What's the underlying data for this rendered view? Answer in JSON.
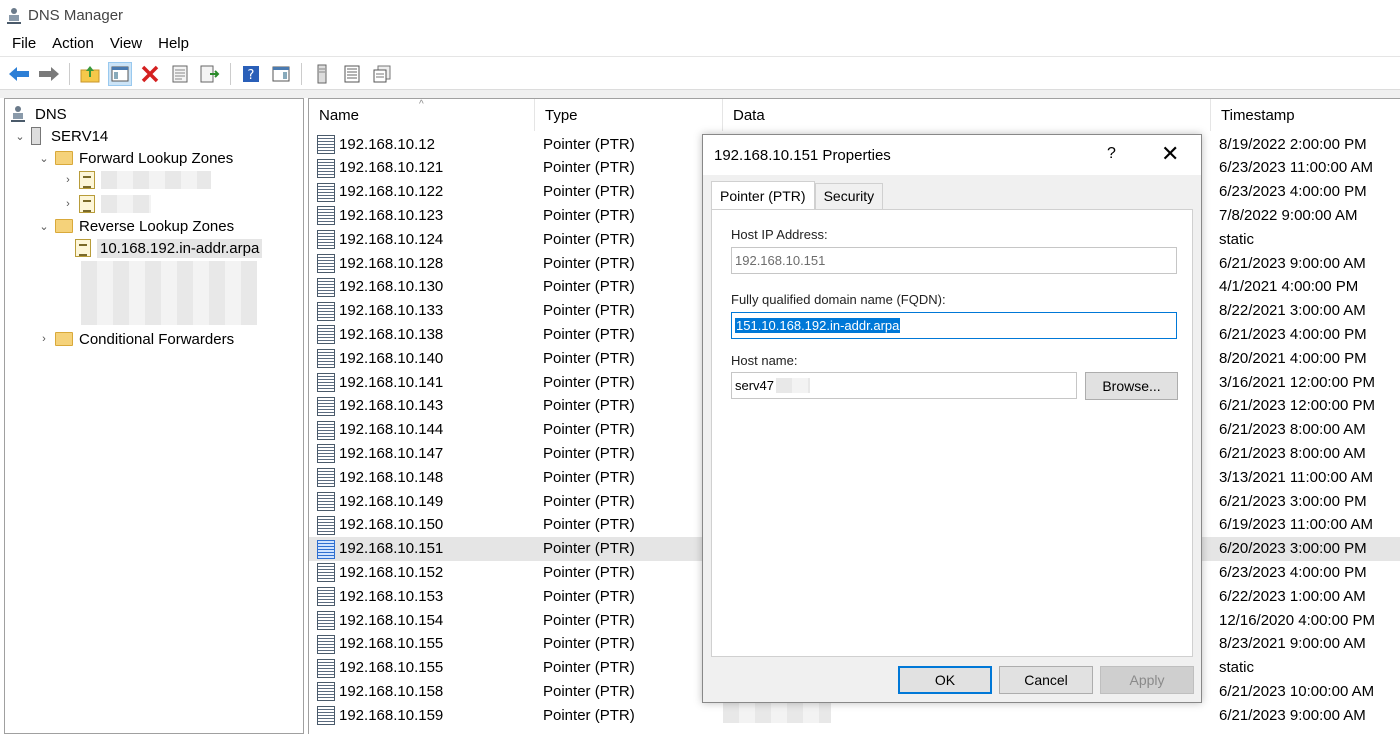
{
  "window": {
    "title": "DNS Manager"
  },
  "menu": [
    "File",
    "Action",
    "View",
    "Help"
  ],
  "toolbar": {
    "icons": [
      "back-arrow-icon",
      "forward-arrow-icon",
      "up-folder-icon",
      "show-hide-tree-icon",
      "delete-icon",
      "properties-icon",
      "export-list-icon",
      "help-icon",
      "action-pane-icon",
      "server-icon",
      "record-list-icon",
      "record-copy-icon"
    ]
  },
  "tree": {
    "root": "DNS",
    "server": "SERV14",
    "forward_zones": "Forward Lookup Zones",
    "reverse_zones": "Reverse Lookup Zones",
    "selected_zone": "10.168.192.in-addr.arpa",
    "conditional_forwarders": "Conditional Forwarders"
  },
  "columns": {
    "name": "Name",
    "type": "Type",
    "data": "Data",
    "timestamp": "Timestamp"
  },
  "records": [
    {
      "name": "192.168.10.12",
      "type": "Pointer (PTR)",
      "timestamp": "8/19/2022 2:00:00 PM"
    },
    {
      "name": "192.168.10.121",
      "type": "Pointer (PTR)",
      "timestamp": "6/23/2023 11:00:00 AM"
    },
    {
      "name": "192.168.10.122",
      "type": "Pointer (PTR)",
      "timestamp": "6/23/2023 4:00:00 PM"
    },
    {
      "name": "192.168.10.123",
      "type": "Pointer (PTR)",
      "timestamp": "7/8/2022 9:00:00 AM"
    },
    {
      "name": "192.168.10.124",
      "type": "Pointer (PTR)",
      "timestamp": "static"
    },
    {
      "name": "192.168.10.128",
      "type": "Pointer (PTR)",
      "timestamp": "6/21/2023 9:00:00 AM"
    },
    {
      "name": "192.168.10.130",
      "type": "Pointer (PTR)",
      "timestamp": "4/1/2021 4:00:00 PM"
    },
    {
      "name": "192.168.10.133",
      "type": "Pointer (PTR)",
      "timestamp": "8/22/2021 3:00:00 AM"
    },
    {
      "name": "192.168.10.138",
      "type": "Pointer (PTR)",
      "timestamp": "6/21/2023 4:00:00 PM"
    },
    {
      "name": "192.168.10.140",
      "type": "Pointer (PTR)",
      "timestamp": "8/20/2021 4:00:00 PM"
    },
    {
      "name": "192.168.10.141",
      "type": "Pointer (PTR)",
      "timestamp": "3/16/2021 12:00:00 PM"
    },
    {
      "name": "192.168.10.143",
      "type": "Pointer (PTR)",
      "timestamp": "6/21/2023 12:00:00 PM"
    },
    {
      "name": "192.168.10.144",
      "type": "Pointer (PTR)",
      "timestamp": "6/21/2023 8:00:00 AM"
    },
    {
      "name": "192.168.10.147",
      "type": "Pointer (PTR)",
      "timestamp": "6/21/2023 8:00:00 AM"
    },
    {
      "name": "192.168.10.148",
      "type": "Pointer (PTR)",
      "timestamp": "3/13/2021 11:00:00 AM"
    },
    {
      "name": "192.168.10.149",
      "type": "Pointer (PTR)",
      "timestamp": "6/21/2023 3:00:00 PM"
    },
    {
      "name": "192.168.10.150",
      "type": "Pointer (PTR)",
      "timestamp": "6/19/2023 11:00:00 AM"
    },
    {
      "name": "192.168.10.151",
      "type": "Pointer (PTR)",
      "timestamp": "6/20/2023 3:00:00 PM",
      "selected": true
    },
    {
      "name": "192.168.10.152",
      "type": "Pointer (PTR)",
      "timestamp": "6/23/2023 4:00:00 PM"
    },
    {
      "name": "192.168.10.153",
      "type": "Pointer (PTR)",
      "timestamp": "6/22/2023 1:00:00 AM"
    },
    {
      "name": "192.168.10.154",
      "type": "Pointer (PTR)",
      "timestamp": "12/16/2020 4:00:00 PM"
    },
    {
      "name": "192.168.10.155",
      "type": "Pointer (PTR)",
      "timestamp": "8/23/2021 9:00:00 AM"
    },
    {
      "name": "192.168.10.155",
      "type": "Pointer (PTR)",
      "timestamp": "static"
    },
    {
      "name": "192.168.10.158",
      "type": "Pointer (PTR)",
      "timestamp": "6/21/2023 10:00:00 AM"
    },
    {
      "name": "192.168.10.159",
      "type": "Pointer (PTR)",
      "timestamp": "6/21/2023 9:00:00 AM"
    }
  ],
  "dialog": {
    "title": "192.168.10.151 Properties",
    "help": "?",
    "close": "✕",
    "tabs": [
      "Pointer (PTR)",
      "Security"
    ],
    "host_ip_label": "Host IP Address:",
    "host_ip_value": "192.168.10.151",
    "fqdn_label": "Fully qualified domain name (FQDN):",
    "fqdn_value": "151.10.168.192.in-addr.arpa",
    "host_name_label": "Host name:",
    "host_name_value": "serv47",
    "browse": "Browse...",
    "ok": "OK",
    "cancel": "Cancel",
    "apply": "Apply"
  }
}
